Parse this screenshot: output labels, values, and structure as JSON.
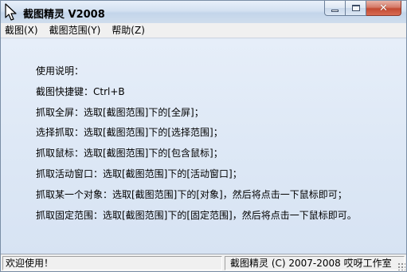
{
  "window": {
    "title": "截图精灵 V2008",
    "controls": {
      "minimize": "minimize-icon",
      "maximize": "maximize-icon",
      "close": "close-icon"
    }
  },
  "menu": [
    {
      "label": "截图(X)"
    },
    {
      "label": "截图范围(Y)"
    },
    {
      "label": "帮助(Z)"
    }
  ],
  "content": {
    "lines": [
      "使用说明：",
      "截图快捷键：Ctrl+B",
      "抓取全屏：选取[截图范围]下的[全屏]；",
      "选择抓取：选取[截图范围]下的[选择范围]；",
      "抓取鼠标：选取[截图范围]下的[包含鼠标]；",
      "抓取活动窗口：选取[截图范围]下的[活动窗口]；",
      "抓取某一个对象：选取[截图范围]下的[对象]，然后将点击一下鼠标即可；",
      "抓取固定范围：选取[截图范围]下的[固定范围]，然后将点击一下鼠标即可。"
    ]
  },
  "status": {
    "left": "欢迎使用！",
    "right": "截图精灵 (C) 2007-2008 哎呀工作室"
  }
}
